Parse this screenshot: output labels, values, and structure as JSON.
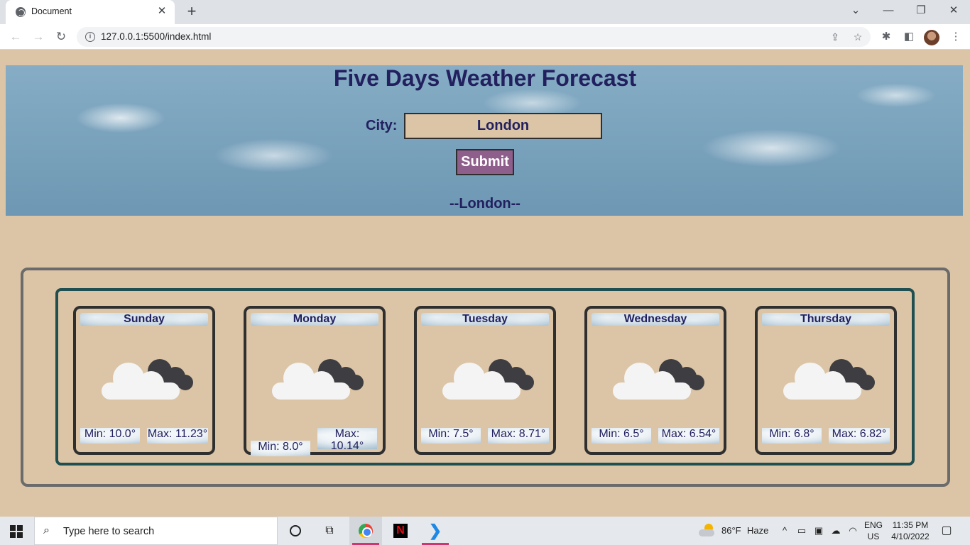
{
  "browser": {
    "tab_title": "Document",
    "url": "127.0.0.1:5500/index.html"
  },
  "page": {
    "title": "Five Days Weather Forecast",
    "city_label": "City:",
    "city_value": "London",
    "submit_label": "Submit",
    "city_heading": "--London--",
    "colors": {
      "background": "#dcc5a6",
      "text": "#22205f",
      "submit": "#8f5f8c",
      "inner_border": "#1f4f51",
      "outer_border": "#6b6b6b"
    }
  },
  "forecast": [
    {
      "day": "Sunday",
      "min": "Min: 10.0°",
      "max": "Max: 11.23°",
      "icon": "partly-cloudy-night-icon"
    },
    {
      "day": "Monday",
      "min": "Min: 8.0°",
      "max": "Max: 10.14°",
      "icon": "partly-cloudy-night-icon"
    },
    {
      "day": "Tuesday",
      "min": "Min: 7.5°",
      "max": "Max: 8.71°",
      "icon": "partly-cloudy-night-icon"
    },
    {
      "day": "Wednesday",
      "min": "Min: 6.5°",
      "max": "Max: 6.54°",
      "icon": "partly-cloudy-night-icon"
    },
    {
      "day": "Thursday",
      "min": "Min: 6.8°",
      "max": "Max: 6.82°",
      "icon": "partly-cloudy-night-icon"
    }
  ],
  "taskbar": {
    "search_placeholder": "Type here to search",
    "weather": "86°F",
    "weather_desc": "Haze",
    "lang": "ENG",
    "region": "US",
    "time": "11:35 PM",
    "date": "4/10/2022"
  }
}
